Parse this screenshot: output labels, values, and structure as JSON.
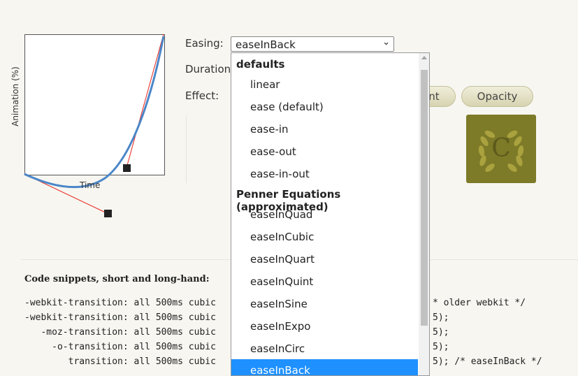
{
  "graph": {
    "y_axis_label": "Animation (%)",
    "x_axis_label": "Time"
  },
  "controls": {
    "easing_label": "Easing:",
    "easing_value": "easeInBack",
    "duration_label": "Duration:",
    "effect_label": "Effect:",
    "effect_buttons": [
      "nt",
      "Opacity"
    ]
  },
  "preview": {
    "logo_letter": "C"
  },
  "code": {
    "title": "Code snippets, short and long-hand:",
    "lines": [
      "-webkit-transition: all 500ms cubic",
      "-webkit-transition: all 500ms cubic",
      "   -moz-transition: all 500ms cubic",
      "     -o-transition: all 500ms cubic",
      "        transition: all 500ms cubic"
    ],
    "line_tails": [
      "* older webkit */",
      "5);",
      "5);",
      "5);",
      "5); /* easeInBack */"
    ]
  },
  "dropdown": {
    "group_defaults": "defaults",
    "defaults": [
      "linear",
      "ease (default)",
      "ease-in",
      "ease-out",
      "ease-in-out"
    ],
    "group_penner": "Penner Equations (approximated)",
    "penner": [
      "easeInQuad",
      "easeInCubic",
      "easeInQuart",
      "easeInQuint",
      "easeInSine",
      "easeInExpo",
      "easeInCirc",
      "easeInBack"
    ],
    "selected": "easeInBack"
  },
  "colors": {
    "curve": "#4a86c8",
    "handle_line": "#e8241a",
    "selected_bg": "#1e90ff",
    "logo_bg": "#7d7a28"
  }
}
